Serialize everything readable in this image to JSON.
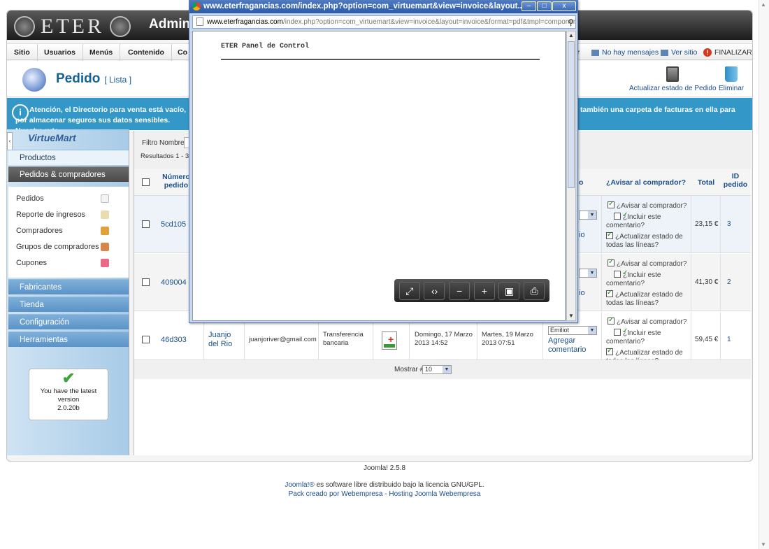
{
  "header": {
    "logo": "ETER",
    "title": "Admini"
  },
  "menu": {
    "items": [
      "Sitio",
      "Usuarios",
      "Menús",
      "Contenido",
      "Co"
    ],
    "right_fragment": "r",
    "messages": "No hay mensajes",
    "view_site": "Ver sitio",
    "logout": "FINALIZAR"
  },
  "toolbar": {
    "title": "Pedido",
    "subtitle": "[ Lista ]",
    "update_status": "Actualizar estado de Pedido",
    "delete": "Eliminar"
  },
  "notice": {
    "left": "Atención, el Directorio para venta está vacío, por almacenar seguros sus datos sensibles. Nuestra ruta",
    "right": "también una carpeta de facturas en ella para"
  },
  "sidebar": {
    "logo": "VirtueMart",
    "productos": "Productos",
    "pedidos": "Pedidos & compradores",
    "submenu": [
      "Pedidos",
      "Reporte de ingresos",
      "Compradores",
      "Grupos de compradores",
      "Cupones"
    ],
    "sections": [
      "Fabricantes",
      "Tienda",
      "Configuración",
      "Herramientas"
    ],
    "version_line1": "You have the latest",
    "version_line2": "version",
    "version_number": "2.0.20b"
  },
  "content": {
    "filter_label": "Filtro Nombre:",
    "results": "Resultados 1 - 3",
    "columns": {
      "order_number": "Número pedido",
      "status_frag": "o",
      "notify": "¿Avisar al comprador?",
      "total": "Total",
      "id": "ID pedido"
    },
    "notify_options": [
      "¿Avisar al comprador?",
      "¿Incluir este comentario?",
      "¿Actualizar estado de todas las líneas?"
    ],
    "rows": [
      {
        "number": "5cd105",
        "status_frag": "io",
        "total": "23,15 €",
        "id": "3"
      },
      {
        "number": "409004",
        "status_frag": "io",
        "total": "41,30 €",
        "id": "2"
      },
      {
        "number": "46d303",
        "name_line1": "Juanjo",
        "name_line2": "del Rio",
        "email": "juanjoriver@gmail.com",
        "payment_line1": "Transferencia",
        "payment_line2": "bancaria",
        "created_line1": "Domingo, 17 Marzo",
        "created_line2": "2013 14:52",
        "modified_line1": "Martes, 19 Marzo",
        "modified_line2": "2013 07:51",
        "status_frag": "Emiliot",
        "comment_line1": "Agregar",
        "comment_line2": "comentario",
        "total": "59,45 €",
        "id": "1"
      }
    ],
    "show_label": "Mostrar #",
    "show_value": "10"
  },
  "footer": {
    "version": "Joomla! 2.5.8",
    "license_link": "Joomla!®",
    "license_text": " es software libre distribuido bajo la licencia GNU/GPL.",
    "pack": "Pack creado por Webempresa - Hosting Joomla Webempresa"
  },
  "popup": {
    "title": "www.eterfragancias.com/index.php?option=com_virtuemart&view=invoice&layout...",
    "url_domain": "www.eterfragancias.com",
    "url_path": "/index.php?option=com_virtuemart&view=invoice&layout=invoice&format=pdf&tmpl=component",
    "pdf_heading": "ETER Panel de Control"
  }
}
